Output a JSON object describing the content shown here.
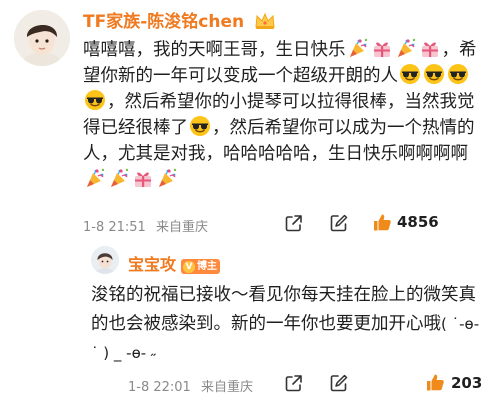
{
  "comment": {
    "username": "TF家族-陈浚铭chen",
    "text_parts": [
      "嘻嘻嘻，我的天啊王哥，生日快乐",
      "，希望你新的一年可以变成一个超级开朗的人",
      "，然后希望你的小提琴可以拉得很棒，当然我觉得已经很棒了",
      "，然后希望你可以成为一个热情的人，尤其是对我，哈哈哈哈哈，生日快乐啊啊啊啊"
    ],
    "emoji_names": [
      "party-popper",
      "gift-ribbon",
      "sunglasses-face"
    ],
    "date": "1-8 21:51",
    "location": "来自重庆",
    "likes": "4856"
  },
  "reply": {
    "username": "宝宝攻",
    "badge": "博主",
    "text": "浚铭的祝福已接收～看见你每天挂在脸上的微笑真的也会被感染到。新的一年你也要更加开心哦",
    "kaomoji": "( ˙-ɵ- ˙ ) _ -ɵ- ˶",
    "date": "1-8 22:01",
    "location": "来自重庆",
    "likes": "203"
  },
  "colors": {
    "username": "#ef7a20",
    "like": "#f08a1a",
    "meta": "#8a8a8a"
  }
}
